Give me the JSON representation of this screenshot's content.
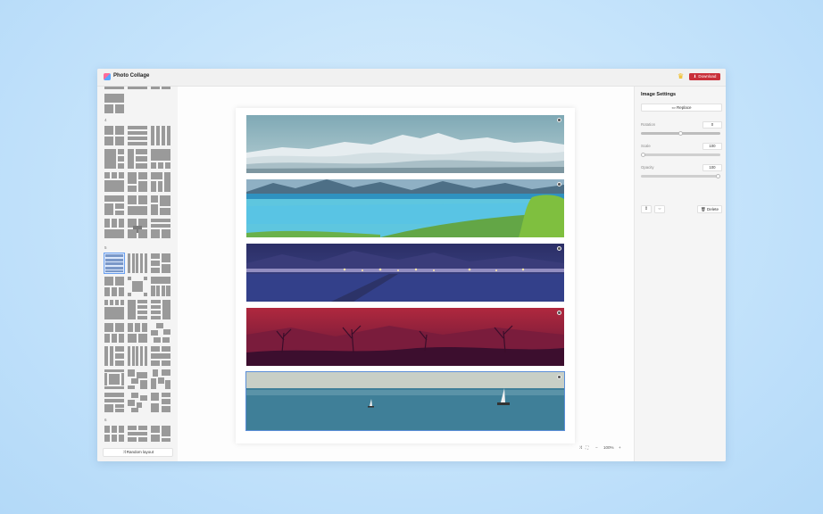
{
  "app": {
    "title": "Photo Collage"
  },
  "header": {
    "download_label": "Download",
    "download_icon": "download-icon",
    "premium_icon": "crown-icon"
  },
  "sidebar": {
    "section_4": "4",
    "section_5": "5",
    "section_6": "6",
    "random_label": "Random layout"
  },
  "canvas": {
    "zoom": "100%",
    "panels": [
      {
        "scene": "snowy mountain range above clouds"
      },
      {
        "scene": "turquoise lake with green hills and mountains"
      },
      {
        "scene": "night lake with city lights"
      },
      {
        "scene": "crimson sunset with bare trees"
      },
      {
        "scene": "calm sea with sailboats"
      }
    ]
  },
  "settings": {
    "title": "Image Settings",
    "replace_label": "Replace",
    "rotation_label": "Rotation",
    "rotation_value": "0",
    "scale_label": "Scale",
    "scale_value": "100",
    "opacity_label": "Opacity",
    "opacity_value": "100",
    "delete_label": "Delete"
  },
  "colors": {
    "accent": "#c9303a",
    "selection": "#5b8fd8"
  }
}
